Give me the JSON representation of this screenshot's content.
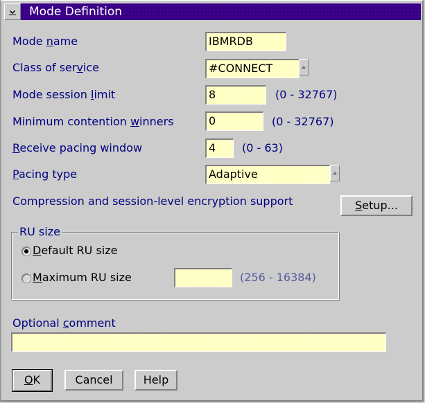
{
  "window": {
    "title": "Mode Definition",
    "system_menu_icon": "system-menu-icon"
  },
  "fields": {
    "mode_name": {
      "label_pre": "Mode ",
      "label_mn": "n",
      "label_post": "ame",
      "value": "IBMRDB"
    },
    "class_of_service": {
      "label_pre": "Class of ser",
      "label_mn": "v",
      "label_post": "ice",
      "value": "#CONNECT",
      "dropdown_icon": "dropdown-arrow-icon"
    },
    "mode_session_limit": {
      "label_pre": "Mode session ",
      "label_mn": "l",
      "label_post": "imit",
      "value": "8",
      "range": "(0 - 32767)"
    },
    "min_contention_winners": {
      "label_pre": "Minimum contention ",
      "label_mn": "w",
      "label_post": "inners",
      "value": "0",
      "range": "(0 - 32767)"
    },
    "receive_pacing_window": {
      "label_pre": "",
      "label_mn": "R",
      "label_post": "eceive pacing window",
      "value": "4",
      "range": "(0 - 63)"
    },
    "pacing_type": {
      "label_pre": "",
      "label_mn": "P",
      "label_post": "acing type",
      "value": "Adaptive",
      "dropdown_icon": "dropdown-arrow-icon"
    },
    "compression": {
      "label": "Compression and session-level encryption support"
    }
  },
  "setup_button": {
    "mn": "S",
    "rest": "etup..."
  },
  "ru_size": {
    "group_label": "RU size",
    "default": {
      "mn": "D",
      "rest": "efault RU size",
      "checked": true
    },
    "maximum": {
      "mn": "M",
      "rest": "aximum RU size",
      "checked": false,
      "value": "",
      "range": "(256 - 16384)"
    }
  },
  "comment": {
    "label_pre": "Optional ",
    "label_mn": "c",
    "label_post": "omment",
    "value": ""
  },
  "buttons": {
    "ok": {
      "mn": "O",
      "rest": "K"
    },
    "cancel": "Cancel",
    "help": "Help"
  },
  "colors": {
    "title_bar": "#4c0099",
    "label_text": "#000080",
    "entry_background": "#ffffc0",
    "dialog_background": "#cccccc"
  }
}
